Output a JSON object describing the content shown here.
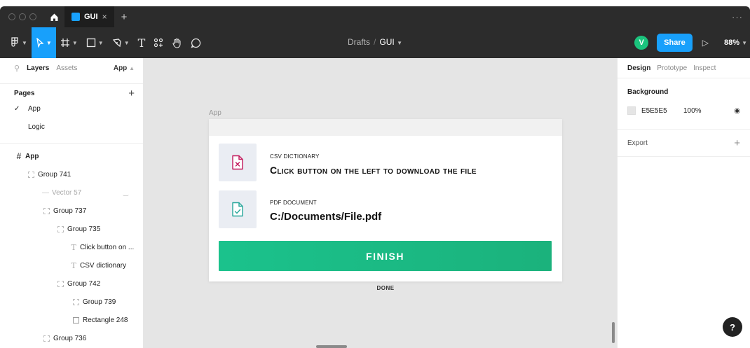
{
  "titlebar": {
    "file_tab": "GUI",
    "close_glyph": "×",
    "new_tab_glyph": "+",
    "more_glyph": "···"
  },
  "toolbar": {
    "tools": [
      "main-menu",
      "move-tool",
      "frame-tool",
      "shape-tool",
      "pen-tool",
      "text-tool",
      "resources-tool",
      "hand-tool",
      "comment-tool"
    ],
    "text_tool_glyph": "T",
    "breadcrumb": {
      "project": "Drafts",
      "separator": "/",
      "file": "GUI"
    },
    "avatar_initial": "V",
    "share_label": "Share",
    "zoom": "88%"
  },
  "left_panel": {
    "tabs": {
      "layers": "Layers",
      "assets": "Assets",
      "page_selector": "App"
    },
    "pages_heading": "Pages",
    "pages": [
      "App",
      "Logic"
    ],
    "current_page": "App",
    "layers": [
      {
        "name": "App",
        "type": "frame",
        "depth": 0
      },
      {
        "name": "Group 741",
        "type": "group",
        "depth": 1
      },
      {
        "name": "Vector 57",
        "type": "vector",
        "depth": 2,
        "hidden": true
      },
      {
        "name": "Group 737",
        "type": "group",
        "depth": 2
      },
      {
        "name": "Group 735",
        "type": "group",
        "depth": 3
      },
      {
        "name": "Click button on ...",
        "type": "text",
        "depth": 4
      },
      {
        "name": "CSV dictionary",
        "type": "text",
        "depth": 4
      },
      {
        "name": "Group 742",
        "type": "group",
        "depth": 3
      },
      {
        "name": "Group 739",
        "type": "group",
        "depth": 4
      },
      {
        "name": "Rectangle 248",
        "type": "rectangle",
        "depth": 4
      },
      {
        "name": "Group 736",
        "type": "group",
        "depth": 2
      }
    ]
  },
  "canvas": {
    "frame_label": "App",
    "rows": [
      {
        "title": "CSV DICTIONARY",
        "main": "Click button on the left to download the file",
        "icon": "file-x-icon",
        "accent": "#c2185b"
      },
      {
        "title": "PDF DOCUMENT",
        "main": "C:/Documents/File.pdf",
        "icon": "file-check-icon",
        "accent": "#26a69a"
      }
    ],
    "finish_label": "FINISH",
    "done_label": "DONE",
    "background": "#e5e5e5",
    "finish_color": "#1bbf86"
  },
  "right_panel": {
    "tabs": {
      "design": "Design",
      "prototype": "Prototype",
      "inspect": "Inspect"
    },
    "background_heading": "Background",
    "background_hex": "E5E5E5",
    "background_opacity": "100%",
    "export_heading": "Export",
    "help_glyph": "?"
  }
}
